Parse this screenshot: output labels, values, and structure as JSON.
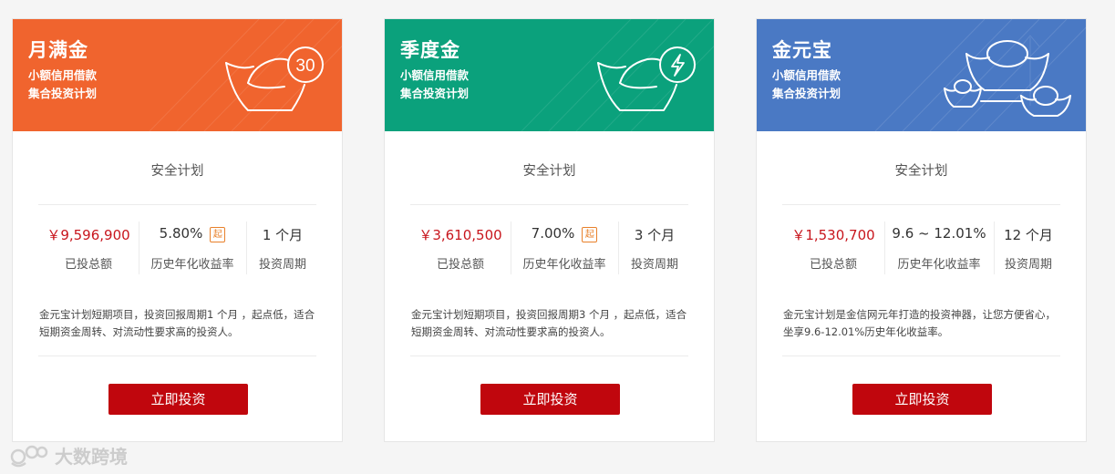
{
  "colors": {
    "orange": "#f0642e",
    "green": "#0ba17c",
    "blue": "#4a79c4",
    "button_red": "#c0060d",
    "amount_red": "#c8161d",
    "badge_orange": "#e8802a"
  },
  "cards": [
    {
      "title": "月满金",
      "subtitle1": "小额信用借款",
      "subtitle2": "集合投资计划",
      "icon_badge": "30",
      "icon": "gold-ingot-30-icon",
      "plan_name": "安全计划",
      "stats": {
        "amount": "￥9,596,900",
        "amount_label": "已投总额",
        "rate": "5.80%",
        "rate_badge": "起",
        "rate_label": "历史年化收益率",
        "period": "1 个月",
        "period_label": "投资周期"
      },
      "description": "金元宝计划短期项目，投资回报周期1 个月 ，起点低，适合短期资金周转、对流动性要求高的投资人。",
      "button": "立即投资"
    },
    {
      "title": "季度金",
      "subtitle1": "小额信用借款",
      "subtitle2": "集合投资计划",
      "icon": "gold-ingot-lightning-icon",
      "plan_name": "安全计划",
      "stats": {
        "amount": "￥3,610,500",
        "amount_label": "已投总额",
        "rate": "7.00%",
        "rate_badge": "起",
        "rate_label": "历史年化收益率",
        "period": "3 个月",
        "period_label": "投资周期"
      },
      "description": "金元宝计划短期项目，投资回报周期3 个月 ，起点低，适合短期资金周转、对流动性要求高的投资人。",
      "button": "立即投资"
    },
    {
      "title": "金元宝",
      "subtitle1": "小额信用借款",
      "subtitle2": "集合投资计划",
      "icon": "gold-ingots-stack-icon",
      "plan_name": "安全计划",
      "stats": {
        "amount": "￥1,530,700",
        "amount_label": "已投总额",
        "rate": "9.6 ~ 12.01%",
        "rate_label": "历史年化收益率",
        "period": "12 个月",
        "period_label": "投资周期"
      },
      "description": "金元宝计划是金信网元年打造的投资神器，让您方便省心，坐享9.6-12.01%历史年化收益率。",
      "button": "立即投资"
    }
  ],
  "watermark": {
    "text": "大数跨境",
    "icon": "watermark-logo-icon"
  }
}
